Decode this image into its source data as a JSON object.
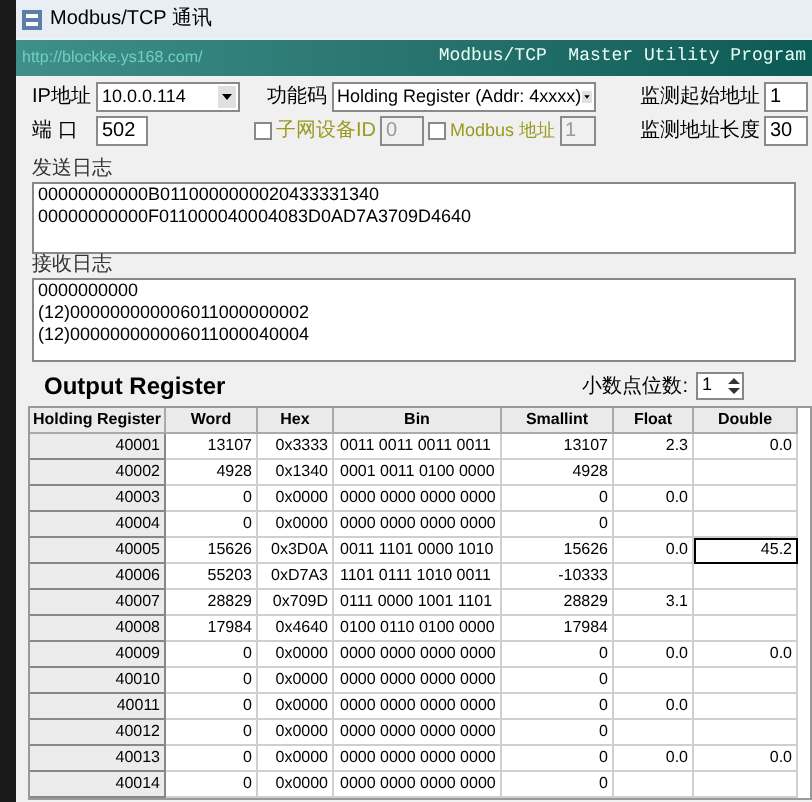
{
  "window": {
    "title": "Modbus/TCP 通讯"
  },
  "banner": {
    "url": "http://blockke.ys168.com/",
    "title": "Modbus/TCP  Master Utility Program"
  },
  "settings": {
    "ip_label": "IP地址",
    "ip": "10.0.0.114",
    "port_label": "端 口",
    "port": "502",
    "function_label": "功能码",
    "function": "Holding Register (Addr: 4xxxx)",
    "slave_id": {
      "label": "子网设备ID",
      "checked": false,
      "value": "0"
    },
    "modbus_address": {
      "label": "Modbus 地址",
      "checked": false,
      "value": "1"
    },
    "start_label": "监测起始地址",
    "start": "1",
    "length_label": "监测地址长度",
    "length": "30"
  },
  "send_log": {
    "title": "发送日志",
    "lines": [
      "00000000000B0110000000020433331340",
      "00000000000F011000040004083D0AD7A3709D4640"
    ]
  },
  "receive_log": {
    "title": "接收日志",
    "lines": [
      "0000000000",
      "(12)000000000006011000000002",
      "(12)000000000006011000040004"
    ]
  },
  "output": {
    "title": "Output Register",
    "decimals_label": "小数点位数:",
    "decimals": "1",
    "columns": [
      "Holding Register",
      "Word",
      "Hex",
      "Bin",
      "Smallint",
      "Float",
      "Double"
    ],
    "rows": [
      {
        "cells": [
          "40001",
          "13107",
          "0x3333",
          "0011 0011 0011 0011",
          "13107",
          "2.3",
          "0.0"
        ],
        "focused": false
      },
      {
        "cells": [
          "40002",
          "4928",
          "0x1340",
          "0001 0011 0100 0000",
          "4928",
          "",
          ""
        ],
        "focused": false
      },
      {
        "cells": [
          "40003",
          "0",
          "0x0000",
          "0000 0000 0000 0000",
          "0",
          "0.0",
          ""
        ],
        "focused": false
      },
      {
        "cells": [
          "40004",
          "0",
          "0x0000",
          "0000 0000 0000 0000",
          "0",
          "",
          ""
        ],
        "focused": false
      },
      {
        "cells": [
          "40005",
          "15626",
          "0x3D0A",
          "0011 1101 0000 1010",
          "15626",
          "0.0",
          "45.2"
        ],
        "focused": true
      },
      {
        "cells": [
          "40006",
          "55203",
          "0xD7A3",
          "1101 0111 1010 0011",
          "-10333",
          "",
          ""
        ],
        "focused": false
      },
      {
        "cells": [
          "40007",
          "28829",
          "0x709D",
          "0111 0000 1001 1101",
          "28829",
          "3.1",
          ""
        ],
        "focused": false
      },
      {
        "cells": [
          "40008",
          "17984",
          "0x4640",
          "0100 0110 0100 0000",
          "17984",
          "",
          ""
        ],
        "focused": false
      },
      {
        "cells": [
          "40009",
          "0",
          "0x0000",
          "0000 0000 0000 0000",
          "0",
          "0.0",
          "0.0"
        ],
        "focused": false
      },
      {
        "cells": [
          "40010",
          "0",
          "0x0000",
          "0000 0000 0000 0000",
          "0",
          "",
          ""
        ],
        "focused": false
      },
      {
        "cells": [
          "40011",
          "0",
          "0x0000",
          "0000 0000 0000 0000",
          "0",
          "0.0",
          ""
        ],
        "focused": false
      },
      {
        "cells": [
          "40012",
          "0",
          "0x0000",
          "0000 0000 0000 0000",
          "0",
          "",
          ""
        ],
        "focused": false
      },
      {
        "cells": [
          "40013",
          "0",
          "0x0000",
          "0000 0000 0000 0000",
          "0",
          "0.0",
          "0.0"
        ],
        "focused": false
      },
      {
        "cells": [
          "40014",
          "0",
          "0x0000",
          "0000 0000 0000 0000",
          "0",
          "",
          ""
        ],
        "focused": false
      }
    ]
  }
}
